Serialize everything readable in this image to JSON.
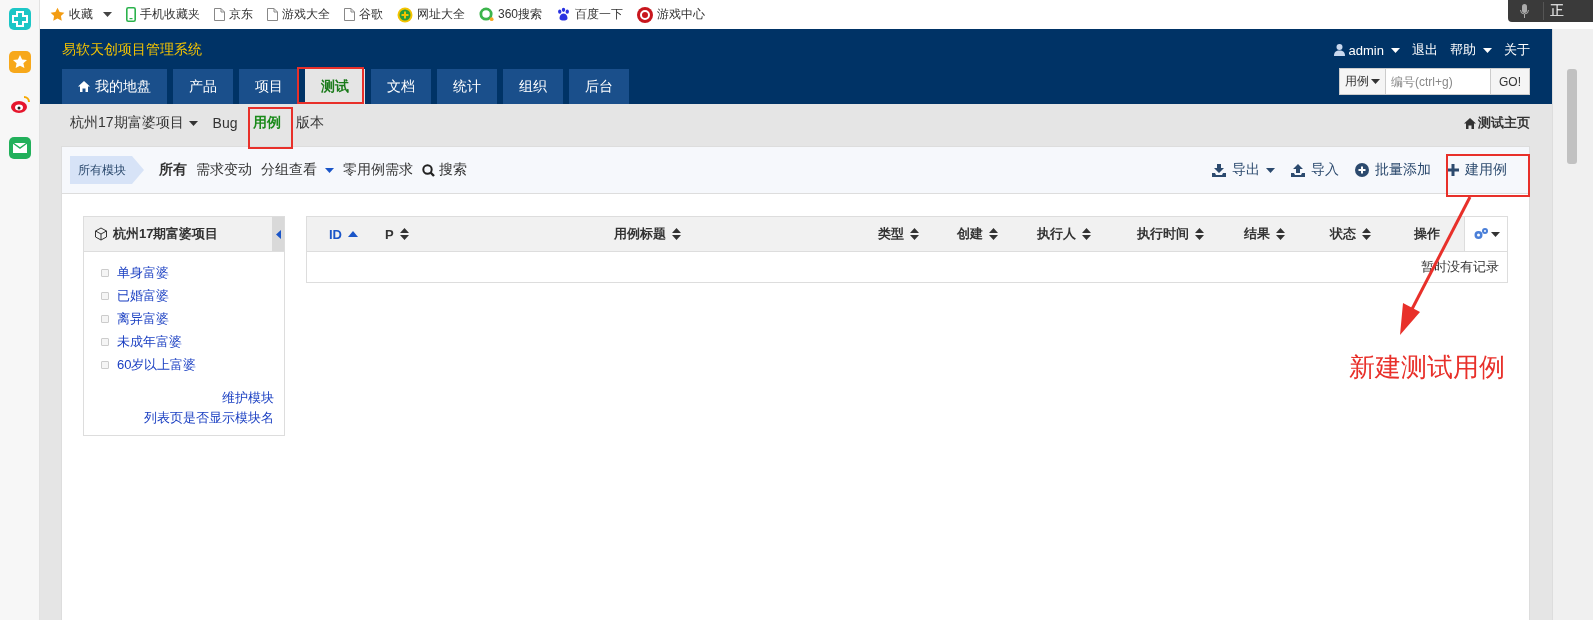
{
  "bookmarks": [
    {
      "label": "收藏",
      "dropdown": true
    },
    {
      "label": "手机收藏夹",
      "dropdown": false
    },
    {
      "label": "京东",
      "dropdown": false
    },
    {
      "label": "游戏大全",
      "dropdown": false
    },
    {
      "label": "谷歌",
      "dropdown": false
    },
    {
      "label": "网址大全",
      "dropdown": false
    },
    {
      "label": "360搜索",
      "dropdown": false
    },
    {
      "label": "百度一下",
      "dropdown": false
    },
    {
      "label": "游戏中心",
      "dropdown": false
    }
  ],
  "voice_widget": {
    "text": "正"
  },
  "header": {
    "title": "易软天创项目管理系统",
    "user_menu": [
      {
        "label": "admin",
        "dropdown": true
      },
      {
        "label": "退出",
        "dropdown": false
      },
      {
        "label": "帮助",
        "dropdown": true
      },
      {
        "label": "关于",
        "dropdown": false
      }
    ],
    "search": {
      "type": "用例",
      "placeholder": "编号(ctrl+g)",
      "button": "GO!"
    }
  },
  "main_tabs": [
    {
      "label": "我的地盘",
      "selected": false
    },
    {
      "label": "产品",
      "selected": false
    },
    {
      "label": "项目",
      "selected": false
    },
    {
      "label": "测试",
      "selected": true
    },
    {
      "label": "文档",
      "selected": false
    },
    {
      "label": "统计",
      "selected": false
    },
    {
      "label": "组织",
      "selected": false
    },
    {
      "label": "后台",
      "selected": false
    }
  ],
  "sub_nav": {
    "items": [
      {
        "label": "杭州17期富婆项目",
        "dropdown": true,
        "selected": false
      },
      {
        "label": "Bug",
        "dropdown": false,
        "selected": false
      },
      {
        "label": "用例",
        "dropdown": false,
        "selected": true
      },
      {
        "label": "版本",
        "dropdown": false,
        "selected": false
      }
    ],
    "home_link": "测试主页"
  },
  "toolbar": {
    "breadcrumb": "所有模块",
    "filters": [
      {
        "label": "所有",
        "selected": true,
        "kind": "link"
      },
      {
        "label": "需求变动",
        "selected": false,
        "kind": "link"
      },
      {
        "label": "分组查看",
        "selected": false,
        "kind": "dropdown"
      },
      {
        "label": "零用例需求",
        "selected": false,
        "kind": "link"
      },
      {
        "label": "搜索",
        "selected": false,
        "kind": "search"
      }
    ],
    "actions": [
      {
        "label": "导出",
        "kind": "export"
      },
      {
        "label": "导入",
        "kind": "import"
      },
      {
        "label": "批量添加",
        "kind": "batch"
      },
      {
        "label": "建用例",
        "kind": "create"
      }
    ]
  },
  "module_tree": {
    "title": "杭州17期富婆项目",
    "items": [
      "单身富婆",
      "已婚富婆",
      "离异富婆",
      "未成年富婆",
      "60岁以上富婆"
    ],
    "links": [
      "维护模块",
      "列表页是否显示模块名"
    ]
  },
  "table": {
    "columns": [
      {
        "label": "ID",
        "sortable": true,
        "sorted": true
      },
      {
        "label": "P",
        "sortable": true,
        "sorted": false
      },
      {
        "label": "用例标题",
        "sortable": true,
        "sorted": false
      },
      {
        "label": "类型",
        "sortable": true,
        "sorted": false
      },
      {
        "label": "创建",
        "sortable": true,
        "sorted": false
      },
      {
        "label": "执行人",
        "sortable": true,
        "sorted": false
      },
      {
        "label": "执行时间",
        "sortable": true,
        "sorted": false
      },
      {
        "label": "结果",
        "sortable": true,
        "sorted": false
      },
      {
        "label": "状态",
        "sortable": true,
        "sorted": false
      },
      {
        "label": "操作",
        "sortable": false,
        "sorted": false
      }
    ],
    "empty_message": "暂时没有记录"
  },
  "annotation": {
    "label": "新建测试用例"
  }
}
